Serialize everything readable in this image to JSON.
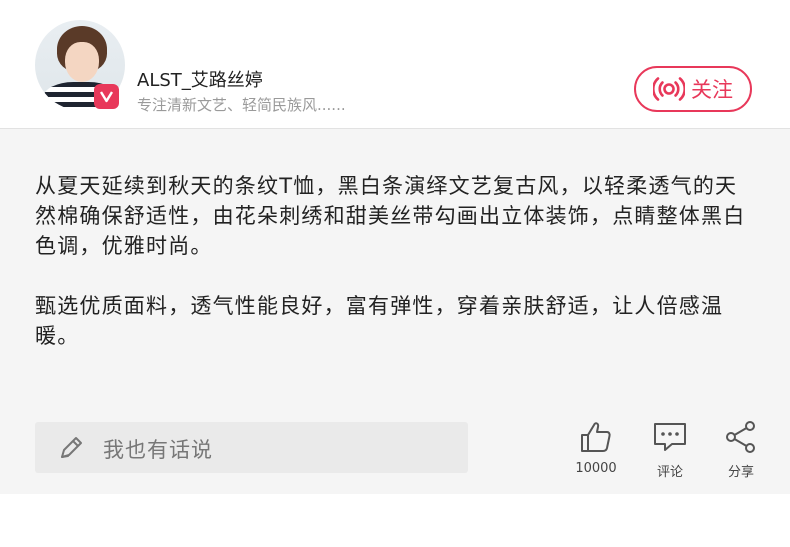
{
  "author": {
    "name": "ALST_艾路丝婷",
    "bio": "专注清新文艺、轻简民族风......",
    "avatar_icon": "avatar-photo",
    "badge_icon": "verified-v-icon"
  },
  "follow_button": {
    "label": "关注",
    "icon": "broadcast-icon",
    "color": "#e8385a"
  },
  "post": {
    "paragraph1": "从夏天延续到秋天的条纹T恤，黑白条演绎文艺复古风，以轻柔透气的天然棉确保舒适性，由花朵刺绣和甜美丝带勾画出立体装饰，点睛整体黑白色调，优雅时尚。",
    "paragraph2": "甄选优质面料，透气性能良好，富有弹性，穿着亲肤舒适，让人倍感温暖。"
  },
  "comment_input": {
    "placeholder": "我也有话说",
    "icon": "pencil-icon"
  },
  "actions": {
    "like_count": "10000",
    "comment_label": "评论",
    "share_label": "分享"
  },
  "colors": {
    "accent": "#e8385a",
    "content_bg": "#f5f5f5",
    "input_bg": "#eaeaea"
  }
}
